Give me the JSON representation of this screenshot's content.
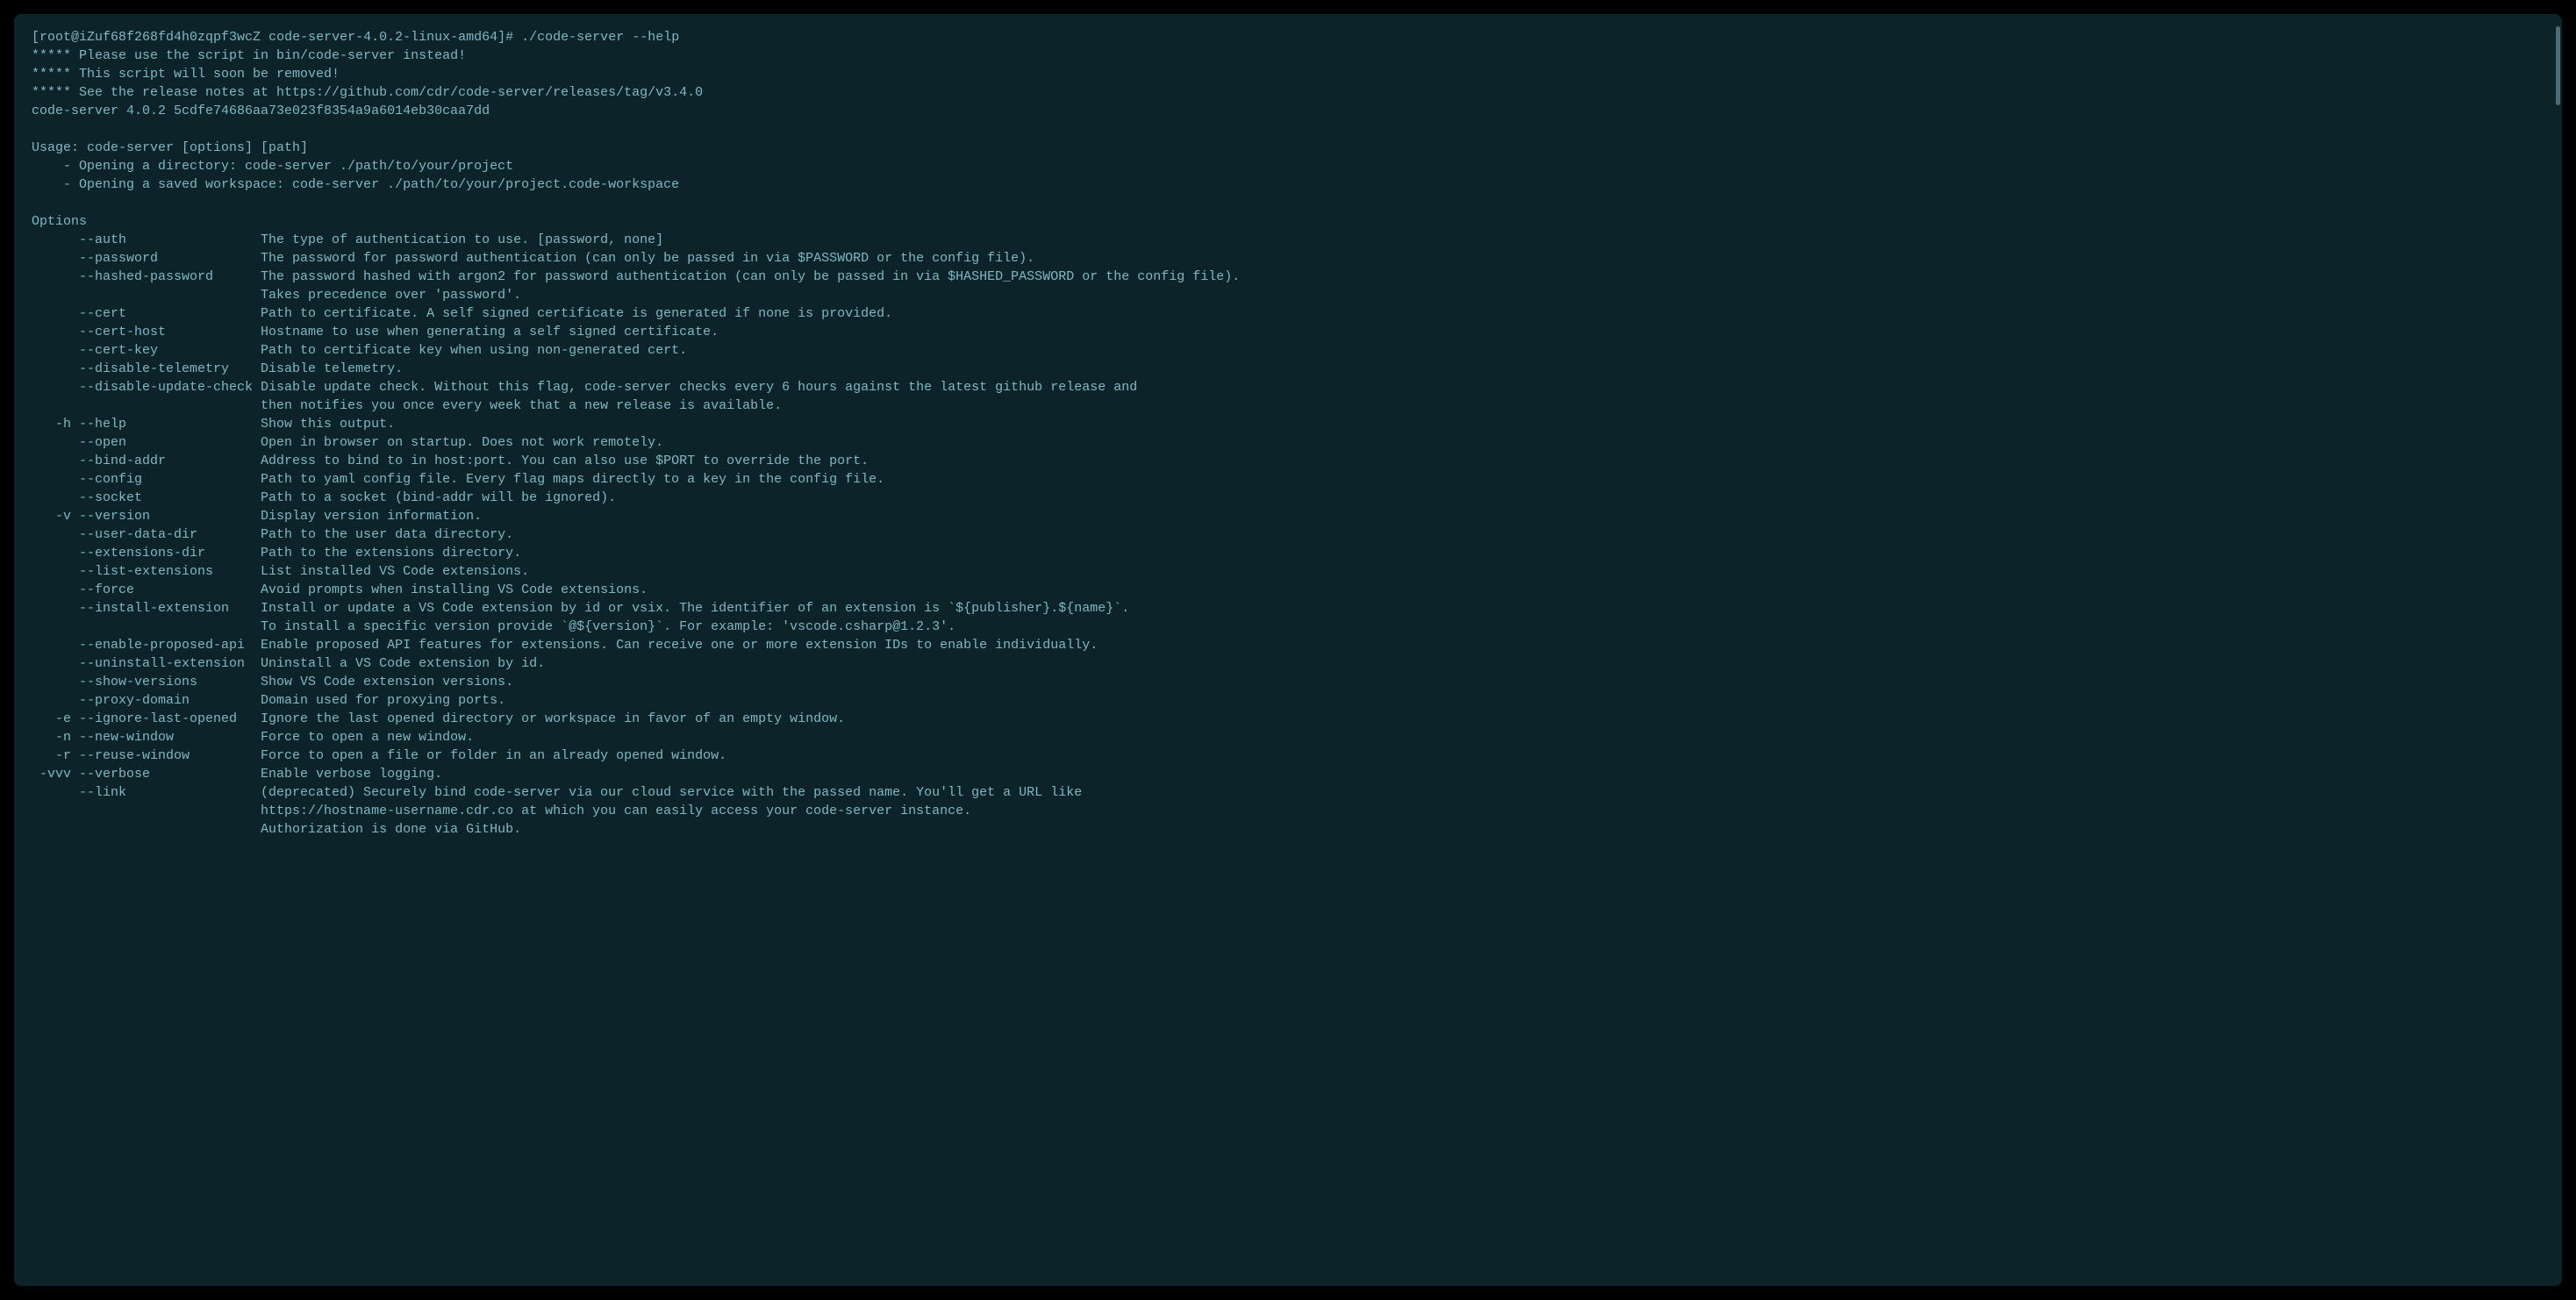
{
  "prompt": {
    "user_host": "root@iZuf68f268fd4h0zqpf3wcZ",
    "cwd": "code-server-4.0.2-linux-amd64",
    "sep_open": "[",
    "sep_close": "]",
    "symbol": "#",
    "command": "./code-server --help"
  },
  "warnings": [
    "***** Please use the script in bin/code-server instead!",
    "***** This script will soon be removed!",
    "***** See the release notes at https://github.com/cdr/code-server/releases/tag/v3.4.0"
  ],
  "version_line": "code-server 4.0.2 5cdfe74686aa73e023f8354a9a6014eb30caa7dd",
  "usage": {
    "heading": "Usage: code-server [options] [path]",
    "examples": [
      "    - Opening a directory: code-server ./path/to/your/project",
      "    - Opening a saved workspace: code-server ./path/to/your/project.code-workspace"
    ]
  },
  "options_heading": "Options",
  "options": [
    {
      "short": "",
      "long": "--auth",
      "desc": "The type of authentication to use. [password, none]"
    },
    {
      "short": "",
      "long": "--password",
      "desc": "The password for password authentication (can only be passed in via $PASSWORD or the config file)."
    },
    {
      "short": "",
      "long": "--hashed-password",
      "desc": "The password hashed with argon2 for password authentication (can only be passed in via $HASHED_PASSWORD or the config file).",
      "desc2": "Takes precedence over 'password'."
    },
    {
      "short": "",
      "long": "--cert",
      "desc": "Path to certificate. A self signed certificate is generated if none is provided."
    },
    {
      "short": "",
      "long": "--cert-host",
      "desc": "Hostname to use when generating a self signed certificate."
    },
    {
      "short": "",
      "long": "--cert-key",
      "desc": "Path to certificate key when using non-generated cert."
    },
    {
      "short": "",
      "long": "--disable-telemetry",
      "desc": "Disable telemetry."
    },
    {
      "short": "",
      "long": "--disable-update-check",
      "desc": "Disable update check. Without this flag, code-server checks every 6 hours against the latest github release and",
      "desc2": "then notifies you once every week that a new release is available."
    },
    {
      "short": "-h",
      "long": "--help",
      "desc": "Show this output."
    },
    {
      "short": "",
      "long": "--open",
      "desc": "Open in browser on startup. Does not work remotely."
    },
    {
      "short": "",
      "long": "--bind-addr",
      "desc": "Address to bind to in host:port. You can also use $PORT to override the port."
    },
    {
      "short": "",
      "long": "--config",
      "desc": "Path to yaml config file. Every flag maps directly to a key in the config file."
    },
    {
      "short": "",
      "long": "--socket",
      "desc": "Path to a socket (bind-addr will be ignored)."
    },
    {
      "short": "-v",
      "long": "--version",
      "desc": "Display version information."
    },
    {
      "short": "",
      "long": "--user-data-dir",
      "desc": "Path to the user data directory."
    },
    {
      "short": "",
      "long": "--extensions-dir",
      "desc": "Path to the extensions directory."
    },
    {
      "short": "",
      "long": "--list-extensions",
      "desc": "List installed VS Code extensions."
    },
    {
      "short": "",
      "long": "--force",
      "desc": "Avoid prompts when installing VS Code extensions."
    },
    {
      "short": "",
      "long": "--install-extension",
      "desc": "Install or update a VS Code extension by id or vsix. The identifier of an extension is `${publisher}.${name}`.",
      "desc2": "To install a specific version provide `@${version}`. For example: 'vscode.csharp@1.2.3'."
    },
    {
      "short": "",
      "long": "--enable-proposed-api",
      "desc": "Enable proposed API features for extensions. Can receive one or more extension IDs to enable individually."
    },
    {
      "short": "",
      "long": "--uninstall-extension",
      "desc": "Uninstall a VS Code extension by id."
    },
    {
      "short": "",
      "long": "--show-versions",
      "desc": "Show VS Code extension versions."
    },
    {
      "short": "",
      "long": "--proxy-domain",
      "desc": "Domain used for proxying ports."
    },
    {
      "short": "-e",
      "long": "--ignore-last-opened",
      "desc": "Ignore the last opened directory or workspace in favor of an empty window."
    },
    {
      "short": "-n",
      "long": "--new-window",
      "desc": "Force to open a new window."
    },
    {
      "short": "-r",
      "long": "--reuse-window",
      "desc": "Force to open a file or folder in an already opened window."
    },
    {
      "short": "-vvv",
      "long": "--verbose",
      "desc": "Enable verbose logging."
    },
    {
      "short": "",
      "long": "--link",
      "desc": "(deprecated) Securely bind code-server via our cloud service with the passed name. You'll get a URL like",
      "desc2": "https://hostname-username.cdr.co at which you can easily access your code-server instance.",
      "desc3": "Authorization is done via GitHub."
    }
  ]
}
